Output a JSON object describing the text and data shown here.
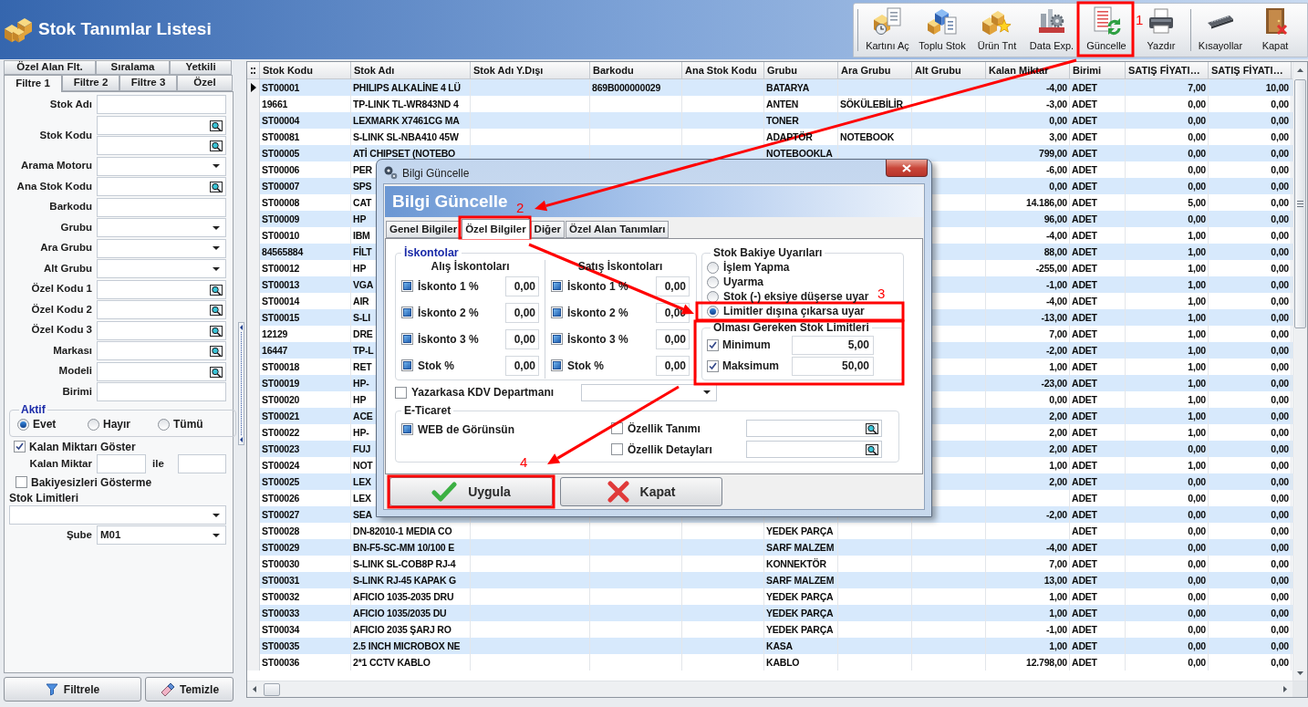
{
  "window": {
    "title": "Stok Tanımlar Listesi"
  },
  "toolbar": [
    [
      {
        "label": "Kartını Aç",
        "kind": "card"
      },
      {
        "label": "Toplu Stok",
        "kind": "bulk"
      },
      {
        "label": "Ürün Tnt",
        "kind": "product"
      },
      {
        "label": "Data Exp.",
        "kind": "export"
      },
      {
        "label": "Güncelle",
        "kind": "update"
      },
      {
        "label": "Yazdır",
        "kind": "print"
      }
    ],
    [
      {
        "label": "Kısayollar",
        "kind": "shortcuts"
      },
      {
        "label": "Kapat",
        "kind": "close"
      }
    ]
  ],
  "filter_panel": {
    "tab_rows": [
      [
        {
          "label": "Özel Alan Flt.",
          "selected": false
        },
        {
          "label": "Sıralama",
          "selected": false
        },
        {
          "label": "Yetkili",
          "selected": false
        }
      ],
      [
        {
          "label": "Filtre 1",
          "selected": true
        },
        {
          "label": "Filtre 2",
          "selected": false
        },
        {
          "label": "Filtre 3",
          "selected": false
        },
        {
          "label": "Özel",
          "selected": false
        }
      ]
    ],
    "fields": [
      {
        "label": "Stok Adı",
        "inputs": [
          {
            "kind": "text"
          }
        ]
      },
      {
        "label": "Stok Kodu",
        "inputs": [
          {
            "kind": "lookup"
          },
          {
            "kind": "lookup"
          }
        ]
      },
      {
        "label": "Arama Motoru",
        "inputs": [
          {
            "kind": "dropdown"
          }
        ]
      },
      {
        "label": "Ana Stok Kodu",
        "inputs": [
          {
            "kind": "lookup"
          }
        ]
      },
      {
        "label": "Barkodu",
        "inputs": [
          {
            "kind": "text"
          }
        ]
      },
      {
        "label": "Grubu",
        "inputs": [
          {
            "kind": "dropdown"
          }
        ]
      },
      {
        "label": "Ara Grubu",
        "inputs": [
          {
            "kind": "dropdown"
          }
        ]
      },
      {
        "label": "Alt Grubu",
        "inputs": [
          {
            "kind": "dropdown"
          }
        ]
      },
      {
        "label": "Özel Kodu 1",
        "inputs": [
          {
            "kind": "lookup"
          }
        ]
      },
      {
        "label": "Özel Kodu 2",
        "inputs": [
          {
            "kind": "lookup"
          }
        ]
      },
      {
        "label": "Özel Kodu 3",
        "inputs": [
          {
            "kind": "lookup"
          }
        ]
      },
      {
        "label": "Markası",
        "inputs": [
          {
            "kind": "lookup"
          }
        ]
      },
      {
        "label": "Modeli",
        "inputs": [
          {
            "kind": "lookup"
          }
        ]
      },
      {
        "label": "Birimi",
        "inputs": [
          {
            "kind": "text"
          }
        ]
      }
    ],
    "active": {
      "title": "Aktif",
      "options": [
        {
          "label": "Evet",
          "selected": true
        },
        {
          "label": "Hayır",
          "selected": false
        },
        {
          "label": "Tümü",
          "selected": false
        }
      ]
    },
    "show_remaining": {
      "label": "Kalan Miktarı Göster",
      "checked": true
    },
    "remaining_range": {
      "label": "Kalan Miktar",
      "joiner": "ile"
    },
    "hide_empty": {
      "label": "Bakiyesizleri Gösterme",
      "checked": false
    },
    "stock_limits": {
      "label": "Stok Limitleri"
    },
    "branch": {
      "label": "Şube",
      "value": "M01"
    },
    "buttons": [
      {
        "label": "Filtrele",
        "kind": "filter"
      },
      {
        "label": "Temizle",
        "kind": "clear"
      }
    ]
  },
  "table": {
    "columns": [
      {
        "label": "Stok Kodu",
        "kind": "text"
      },
      {
        "label": "Stok Adı",
        "kind": "text"
      },
      {
        "label": "Stok Adı Y.Dışı",
        "kind": "text"
      },
      {
        "label": "Barkodu",
        "kind": "text"
      },
      {
        "label": "Ana Stok Kodu",
        "kind": "text"
      },
      {
        "label": "Grubu",
        "kind": "text"
      },
      {
        "label": "Ara Grubu",
        "kind": "text"
      },
      {
        "label": "Alt Grubu",
        "kind": "text"
      },
      {
        "label": "Kalan Miktar",
        "kind": "number"
      },
      {
        "label": "Birimi",
        "kind": "text"
      },
      {
        "label": "SATIŞ FİYATI…",
        "kind": "number"
      },
      {
        "label": "SATIŞ FİYATI…",
        "kind": "number"
      }
    ],
    "rows": [
      {
        "selected": true,
        "code": "ST00001",
        "name": "PHILIPS ALKALİNE 4 LÜ",
        "barcode": "869B000000029",
        "group": "BATARYA",
        "remaining": "-4,00",
        "unit": "ADET",
        "price_1": "7,00",
        "price_2": "10,00"
      },
      {
        "selected": false,
        "code": "19661",
        "name": "TP-LINK TL-WR843ND 4",
        "group": "ANTEN",
        "mid_group": "SÖKÜLEBİLİR",
        "remaining": "-3,00",
        "unit": "ADET",
        "price_1": "0,00",
        "price_2": "0,00"
      },
      {
        "selected": false,
        "code": "ST00004",
        "name": "LEXMARK X7461CG MA",
        "group": "TONER",
        "remaining": "0,00",
        "unit": "ADET",
        "price_1": "0,00",
        "price_2": "0,00"
      },
      {
        "selected": false,
        "code": "ST00081",
        "name": "S-LINK SL-NBA410 45W",
        "group": "ADAPTÖR",
        "mid_group": "NOTEBOOK",
        "remaining": "3,00",
        "unit": "ADET",
        "price_1": "0,00",
        "price_2": "0,00"
      },
      {
        "selected": false,
        "code": "ST00005",
        "name": "ATİ CHIPSET (NOTEBO",
        "group": "NOTEBOOKLA",
        "remaining": "799,00",
        "unit": "ADET",
        "price_1": "0,00",
        "price_2": "0,00"
      },
      {
        "selected": false,
        "code": "ST00006",
        "name": "PER",
        "remaining": "-6,00",
        "unit": "ADET",
        "price_1": "0,00",
        "price_2": "0,00"
      },
      {
        "selected": false,
        "code": "ST00007",
        "name": "SPS",
        "remaining": "0,00",
        "unit": "ADET",
        "price_1": "0,00",
        "price_2": "0,00"
      },
      {
        "selected": false,
        "code": "ST00008",
        "name": "CAT",
        "remaining": "14.186,00",
        "unit": "ADET",
        "price_1": "5,00",
        "price_2": "0,00"
      },
      {
        "selected": false,
        "code": "ST00009",
        "name": "HP",
        "remaining": "96,00",
        "unit": "ADET",
        "price_1": "0,00",
        "price_2": "0,00"
      },
      {
        "selected": false,
        "code": "ST00010",
        "name": "IBM",
        "remaining": "-4,00",
        "unit": "ADET",
        "price_1": "1,00",
        "price_2": "0,00"
      },
      {
        "selected": false,
        "code": "84565884",
        "name": "FİLT",
        "remaining": "88,00",
        "unit": "ADET",
        "price_1": "1,00",
        "price_2": "0,00"
      },
      {
        "selected": false,
        "code": "ST00012",
        "name": "HP",
        "remaining": "-255,00",
        "unit": "ADET",
        "price_1": "1,00",
        "price_2": "0,00"
      },
      {
        "selected": false,
        "code": "ST00013",
        "name": "VGA",
        "remaining": "-1,00",
        "unit": "ADET",
        "price_1": "1,00",
        "price_2": "0,00"
      },
      {
        "selected": false,
        "code": "ST00014",
        "name": "AIR",
        "remaining": "-4,00",
        "unit": "ADET",
        "price_1": "1,00",
        "price_2": "0,00"
      },
      {
        "selected": false,
        "code": "ST00015",
        "name": "S-LI",
        "remaining": "-13,00",
        "unit": "ADET",
        "price_1": "1,00",
        "price_2": "0,00"
      },
      {
        "selected": false,
        "code": "12129",
        "name": "DRE",
        "remaining": "7,00",
        "unit": "ADET",
        "price_1": "1,00",
        "price_2": "0,00"
      },
      {
        "selected": false,
        "code": "16447",
        "name": "TP-L",
        "remaining": "-2,00",
        "unit": "ADET",
        "price_1": "1,00",
        "price_2": "0,00"
      },
      {
        "selected": false,
        "code": "ST00018",
        "name": "RET",
        "remaining": "1,00",
        "unit": "ADET",
        "price_1": "1,00",
        "price_2": "0,00"
      },
      {
        "selected": false,
        "code": "ST00019",
        "name": "HP-",
        "remaining": "-23,00",
        "unit": "ADET",
        "price_1": "1,00",
        "price_2": "0,00"
      },
      {
        "selected": false,
        "code": "ST00020",
        "name": "HP",
        "remaining": "0,00",
        "unit": "ADET",
        "price_1": "1,00",
        "price_2": "0,00"
      },
      {
        "selected": false,
        "code": "ST00021",
        "name": "ACE",
        "remaining": "2,00",
        "unit": "ADET",
        "price_1": "1,00",
        "price_2": "0,00"
      },
      {
        "selected": false,
        "code": "ST00022",
        "name": "HP-",
        "remaining": "2,00",
        "unit": "ADET",
        "price_1": "1,00",
        "price_2": "0,00"
      },
      {
        "selected": false,
        "code": "ST00023",
        "name": "FUJ",
        "remaining": "2,00",
        "unit": "ADET",
        "price_1": "0,00",
        "price_2": "0,00"
      },
      {
        "selected": false,
        "code": "ST00024",
        "name": "NOT",
        "remaining": "1,00",
        "unit": "ADET",
        "price_1": "1,00",
        "price_2": "0,00"
      },
      {
        "selected": false,
        "code": "ST00025",
        "name": "LEX",
        "remaining": "2,00",
        "unit": "ADET",
        "price_1": "0,00",
        "price_2": "0,00"
      },
      {
        "selected": false,
        "code": "ST00026",
        "name": "LEX",
        "unit": "ADET",
        "price_1": "0,00",
        "price_2": "0,00"
      },
      {
        "selected": false,
        "code": "ST00027",
        "name": "SEA",
        "remaining": "-2,00",
        "unit": "ADET",
        "price_1": "0,00",
        "price_2": "0,00"
      },
      {
        "selected": false,
        "code": "ST00028",
        "name": "DN-82010-1 MEDIA CO",
        "group": "YEDEK PARÇA",
        "unit": "ADET",
        "price_1": "0,00",
        "price_2": "0,00"
      },
      {
        "selected": false,
        "code": "ST00029",
        "name": "BN-F5-SC-MM 10/100 E",
        "group": "SARF MALZEM",
        "remaining": "-4,00",
        "unit": "ADET",
        "price_1": "0,00",
        "price_2": "0,00"
      },
      {
        "selected": false,
        "code": "ST00030",
        "name": "S-LINK SL-COB8P RJ-4",
        "group": "KONNEKTÖR",
        "remaining": "7,00",
        "unit": "ADET",
        "price_1": "0,00",
        "price_2": "0,00"
      },
      {
        "selected": false,
        "code": "ST00031",
        "name": "S-LINK RJ-45 KAPAK G",
        "group": "SARF MALZEM",
        "remaining": "13,00",
        "unit": "ADET",
        "price_1": "0,00",
        "price_2": "0,00"
      },
      {
        "selected": false,
        "code": "ST00032",
        "name": "AFICIO 1035-2035 DRU",
        "group": "YEDEK PARÇA",
        "remaining": "1,00",
        "unit": "ADET",
        "price_1": "0,00",
        "price_2": "0,00"
      },
      {
        "selected": false,
        "code": "ST00033",
        "name": "AFICIO 1035/2035 DU",
        "group": "YEDEK PARÇA",
        "remaining": "1,00",
        "unit": "ADET",
        "price_1": "0,00",
        "price_2": "0,00"
      },
      {
        "selected": false,
        "code": "ST00034",
        "name": "AFICIO 2035 ŞARJ RO",
        "group": "YEDEK PARÇA",
        "remaining": "-1,00",
        "unit": "ADET",
        "price_1": "0,00",
        "price_2": "0,00"
      },
      {
        "selected": false,
        "code": "ST00035",
        "name": "2.5 INCH MICROBOX NE",
        "group": "KASA",
        "remaining": "1,00",
        "unit": "ADET",
        "price_1": "0,00",
        "price_2": "0,00"
      },
      {
        "selected": false,
        "code": "ST00036",
        "name": "2*1 CCTV KABLO",
        "group": "KABLO",
        "remaining": "12.798,00",
        "unit": "ADET",
        "price_1": "0,00",
        "price_2": "0,00"
      }
    ]
  },
  "dialog": {
    "title": "Bilgi Güncelle",
    "heading": "Bilgi Güncelle",
    "tabs": [
      {
        "label": "Genel Bilgiler",
        "selected": false
      },
      {
        "label": "Özel Bilgiler",
        "selected": true
      },
      {
        "label": "Diğer",
        "selected": false
      },
      {
        "label": "Özel Alan Tanımları",
        "selected": false
      }
    ],
    "discounts": {
      "title": "İskontolar",
      "columns": [
        {
          "heading": "Alış İskontoları",
          "rows": [
            {
              "label": "İskonto 1 %",
              "indeterminate": true,
              "value": "0,00"
            },
            {
              "label": "İskonto 2 %",
              "indeterminate": true,
              "value": "0,00"
            },
            {
              "label": "İskonto 3 %",
              "indeterminate": true,
              "value": "0,00"
            },
            {
              "label": "Stok %",
              "indeterminate": true,
              "value": "0,00"
            }
          ]
        },
        {
          "heading": "Satış İskontoları",
          "rows": [
            {
              "label": "İskonto 1 %",
              "indeterminate": true,
              "value": "0,00"
            },
            {
              "label": "İskonto 2 %",
              "indeterminate": true,
              "value": "0,00"
            },
            {
              "label": "İskonto 3 %",
              "indeterminate": true,
              "value": "0,00"
            },
            {
              "label": "Stok %",
              "indeterminate": true,
              "value": "0,00"
            }
          ]
        }
      ]
    },
    "balance_warnings": {
      "title": "Stok Bakiye Uyarıları",
      "options": [
        {
          "label": "İşlem Yapma",
          "selected": false
        },
        {
          "label": "Uyarma",
          "selected": false
        },
        {
          "label": "Stok (-) eksiye düşerse uyar",
          "selected": false
        },
        {
          "label": "Limitler dışına çıkarsa uyar",
          "selected": true
        }
      ]
    },
    "stock_limits": {
      "title": "Olması Gereken Stok Limitleri",
      "rows": [
        {
          "label": "Minimum",
          "checked": true,
          "value": "5,00"
        },
        {
          "label": "Maksimum",
          "checked": true,
          "value": "50,00"
        }
      ]
    },
    "cash_register": {
      "label": "Yazarkasa KDV Departmanı",
      "checked": false
    },
    "e_commerce": {
      "title": "E-Ticaret",
      "web": {
        "label": "WEB de Görünsün",
        "indeterminate": true
      },
      "properties": [
        {
          "label": "Özellik Tanımı",
          "checked": false
        },
        {
          "label": "Özellik Detayları",
          "checked": false
        }
      ]
    },
    "buttons": [
      {
        "label": "Uygula",
        "kind": "apply"
      },
      {
        "label": "Kapat",
        "kind": "close"
      }
    ]
  },
  "annotations": {
    "steps": [
      "1",
      "2",
      "3",
      "4"
    ]
  }
}
